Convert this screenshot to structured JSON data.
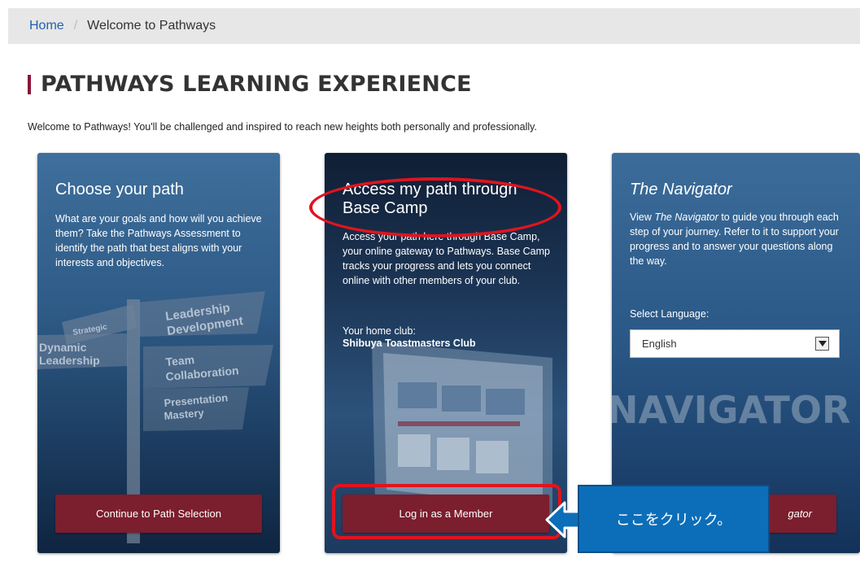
{
  "breadcrumb": {
    "home": "Home",
    "separator": "/",
    "current": "Welcome to Pathways"
  },
  "page": {
    "title": "PATHWAYS LEARNING EXPERIENCE",
    "intro": "Welcome to Pathways! You'll be challenged and inspired to reach new heights both personally and professionally."
  },
  "cards": {
    "choose": {
      "heading": "Choose your path",
      "body": "What are your goals and how will you achieve them? Take the Pathways Assessment to identify the path that best aligns with your interests and objectives.",
      "button": "Continue to Path Selection",
      "signpost": [
        "Strategic",
        "Leadership",
        "Development",
        "Dynamic",
        "Leadership",
        "Team",
        "Collaboration",
        "Presentation",
        "Mastery"
      ]
    },
    "access": {
      "heading": "Access my path through Base Camp",
      "body": "Access your path here through Base Camp, your online gateway to Pathways. Base Camp tracks your progress and lets you connect online with other members of your club.",
      "home_club_label": "Your home club:",
      "home_club_name": "Shibuya Toastmasters Club",
      "button": "Log in as a Member"
    },
    "navigator": {
      "heading": "The Navigator",
      "body_prefix": "View ",
      "body_italic": "The Navigator",
      "body_suffix": " to guide you through each step of your journey. Refer to it to support your progress and to answer your questions along the way.",
      "language_label": "Select Language:",
      "language_selected": "English",
      "watermark": "NAVIGATOR",
      "button": "gator"
    }
  },
  "callout": {
    "text": "ここをクリック。"
  },
  "colors": {
    "accent": "#8a1538",
    "button": "#7b1e2e",
    "link": "#2261b0",
    "highlight": "#e0141e",
    "callout": "#0c6eb8"
  }
}
